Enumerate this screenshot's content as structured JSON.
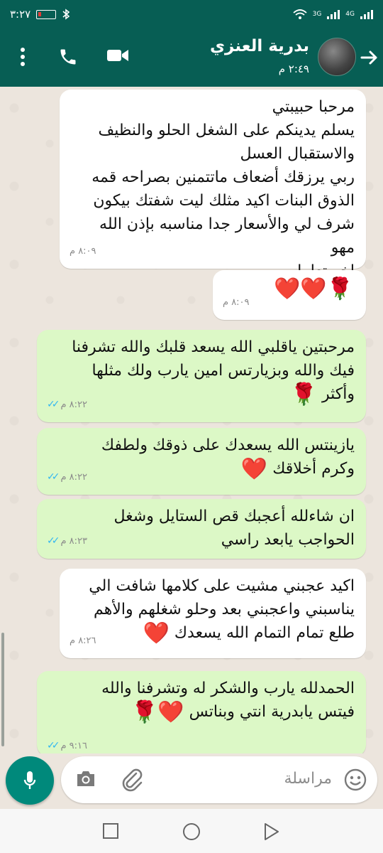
{
  "status_bar": {
    "time": "٣:٢٧",
    "network_left": "3G",
    "network_right": "4G"
  },
  "header": {
    "contact_name": "بدرية العنزي",
    "last_seen": "٢:٤٩ م"
  },
  "messages": [
    {
      "direction": "incoming",
      "text": [
        "مرحبا حبيبتي",
        "يسلم يدينكم على الشغل الحلو والنظيف",
        "والاستقبال العسل",
        "ربي يرزقك أضعاف ماتتمنين بصراحه قمه",
        "الذوق البنات اكيد مثلك ليت شفتك بيكون",
        "شرف لي والأسعار جدا مناسبه بإذن الله مهو",
        "اخر تعامل"
      ],
      "time": "٨:٠٩ م"
    },
    {
      "direction": "incoming",
      "text": [],
      "emoji": "🌹❤️❤️",
      "time": "٨:٠٩ م"
    },
    {
      "direction": "outgoing",
      "text": [
        "مرحبتين ياقلبي الله يسعد قلبك والله تشرفنا",
        "فيك والله وبزيارتس امين يارب ولك مثلها",
        "وأكثر"
      ],
      "emoji": "🌹",
      "time": "٨:٢٢ م"
    },
    {
      "direction": "outgoing",
      "text": [
        "يازينتس الله يسعدك على ذوقك ولطفك",
        "وكرم أخلاقك"
      ],
      "emoji": "❤️",
      "time": "٨:٢٢ م"
    },
    {
      "direction": "outgoing",
      "text": [
        "ان شاءلله أعجبك قص الستايل وشغل",
        "الحواجب يابعد راسي"
      ],
      "time": "٨:٢٣ م"
    },
    {
      "direction": "incoming",
      "text": [
        "اكيد عجبني مشيت على كلامها شافت الي",
        "يناسبني واعجبني بعد وحلو شغلهم والأهم",
        "طلع تمام التمام الله يسعدك"
      ],
      "emoji": "❤️",
      "time": "٨:٢٦ م"
    },
    {
      "direction": "outgoing",
      "text": [
        "الحمدلله يارب والشكر له وتشرفنا والله",
        "فيتس يابدرية انتي وبناتس"
      ],
      "emoji": "❤️🌹",
      "time": "٩:١٦ م"
    }
  ],
  "composer": {
    "placeholder": "مراسلة"
  },
  "colors": {
    "header": "#075e54",
    "outgoing_bubble": "#dcf8c6",
    "incoming_bubble": "#ffffff",
    "mic_button": "#00897b",
    "read_ticks": "#34b7f1"
  }
}
